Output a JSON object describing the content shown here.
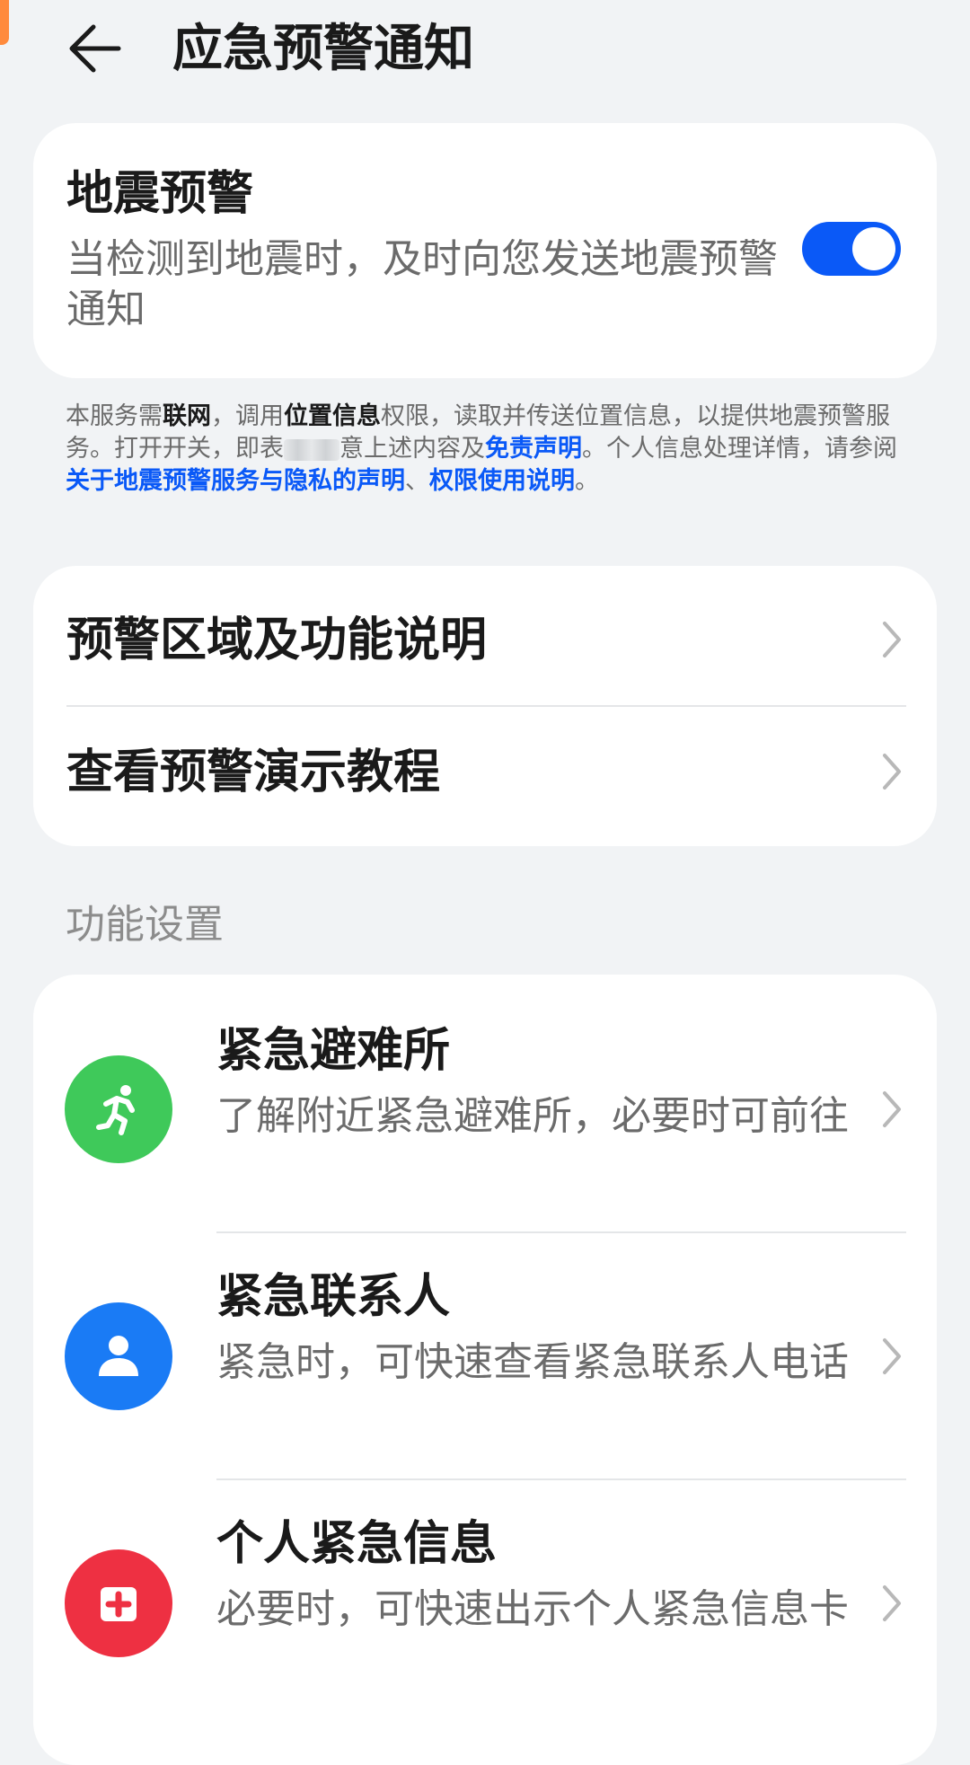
{
  "header": {
    "back_icon": "arrow-left-icon",
    "title": "应急预警通知"
  },
  "earthquake_card": {
    "title": "地震预警",
    "description": "当检测到地震时，及时向您发送地震预警通知",
    "toggle": {
      "state": "on",
      "color": "#0a59f7"
    }
  },
  "notice": {
    "part1": "本服务需",
    "bold1": "联网",
    "part2": "，调用",
    "bold2": "位置信息",
    "part3": "权限，读取并传送位置信息，以提供地震预警服务。打开开关，即表",
    "part4": "意上述内容及",
    "link1": "免责声明",
    "part5": "。个人信息处理详情，请参阅",
    "link2": "关于地震预警服务与隐私的声明",
    "part6": "、",
    "link3": "权限使用说明",
    "part7": "。",
    "link_color": "#0a59f7"
  },
  "info_card": {
    "items": [
      {
        "label": "预警区域及功能说明"
      },
      {
        "label": "查看预警演示教程"
      }
    ]
  },
  "section": {
    "label": "功能设置"
  },
  "settings_card": {
    "items": [
      {
        "title": "紧急避难所",
        "description": "了解附近紧急避难所，必要时可前往",
        "icon": "running-person-icon",
        "color": "#3fc95a"
      },
      {
        "title": "紧急联系人",
        "description": "紧急时，可快速查看紧急联系人电话",
        "icon": "person-icon",
        "color": "#1a7bf5"
      },
      {
        "title": "个人紧急信息",
        "description": "必要时，可快速出示个人紧急信息卡",
        "icon": "medical-cross-icon",
        "color": "#ee3042"
      }
    ]
  }
}
